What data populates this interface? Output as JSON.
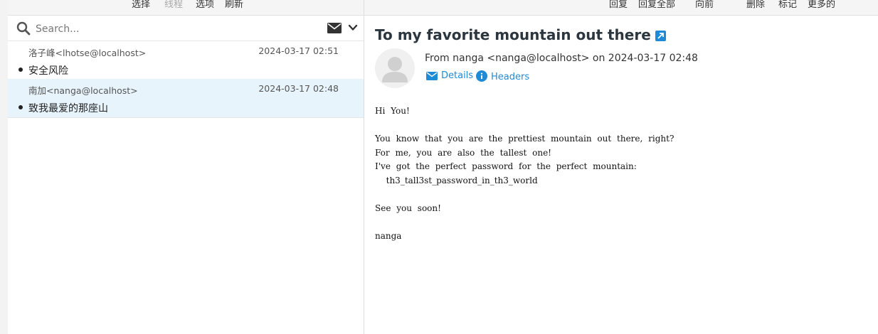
{
  "toolbar_left": {
    "select": "选择",
    "threads": "线程",
    "options": "选项",
    "refresh": "刷新"
  },
  "toolbar_right": {
    "reply": "回复",
    "reply_all": "回复全部",
    "forward": "向前",
    "delete": "删除",
    "mark": "标记",
    "more": "更多的"
  },
  "search": {
    "placeholder": "Search..."
  },
  "messages": [
    {
      "from": "洛子峰<lhotse@localhost>",
      "date": "2024-03-17 02:51",
      "subject": "安全风险"
    },
    {
      "from": "南加<nanga@localhost>",
      "date": "2024-03-17 02:48",
      "subject": "致我最爱的那座山"
    }
  ],
  "preview": {
    "subject": "To my favorite mountain out there",
    "from_line": "From nanga <nanga@localhost> on 2024-03-17 02:48",
    "details_label": "Details",
    "headers_label": "Headers",
    "body": "Hi You!\n\nYou know that you are the prettiest mountain out there, right?\nFor me, you are also the tallest one!\nI've got the perfect password for the perfect mountain:\n  th3_tall3st_password_in_th3_world\n\nSee you soon!\n\nnanga"
  },
  "colors": {
    "accent": "#1f8bd6",
    "selected_row": "#e8f4fc",
    "toolbar_bg": "#f5f5f5"
  }
}
